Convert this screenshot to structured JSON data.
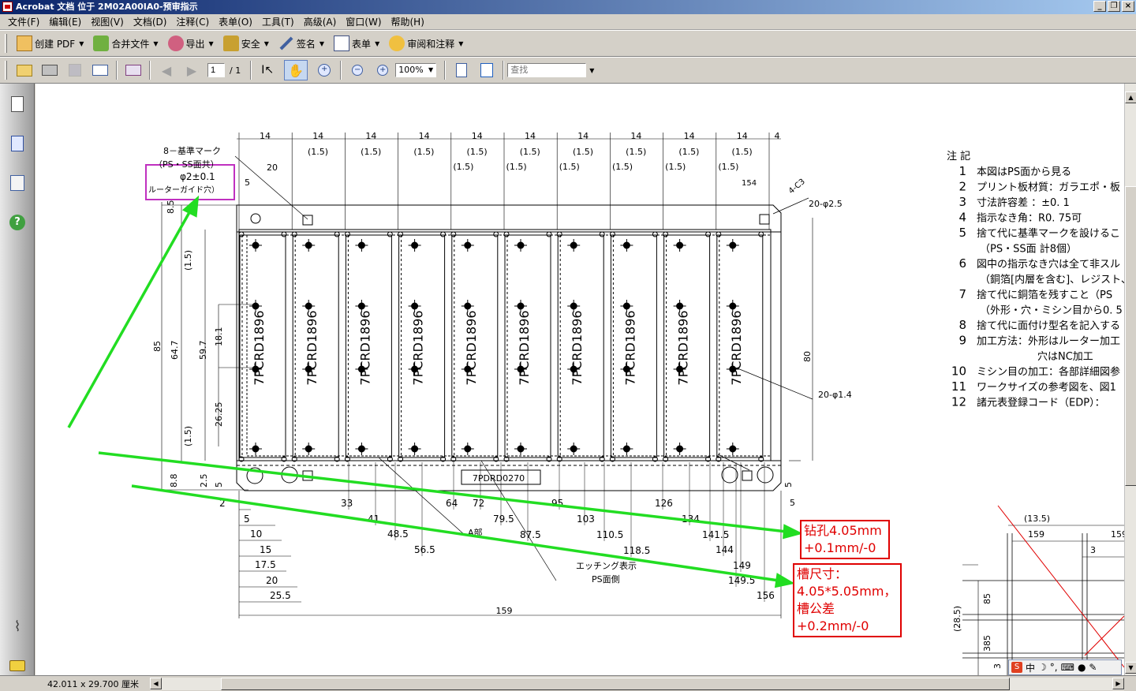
{
  "window": {
    "title": "Acrobat 文档 位于 2M02A00IA0-预审指示"
  },
  "menu": [
    "文件(F)",
    "编辑(E)",
    "视图(V)",
    "文档(D)",
    "注释(C)",
    "表单(O)",
    "工具(T)",
    "高级(A)",
    "窗口(W)",
    "帮助(H)"
  ],
  "toolbar1": {
    "create_pdf": "创建 PDF",
    "combine": "合并文件",
    "export": "导出",
    "security": "安全",
    "sign": "签名",
    "forms": "表单",
    "review": "审阅和注释"
  },
  "toolbar2": {
    "page_current": "1",
    "page_total": "/ 1",
    "zoom": "100%",
    "find_placeholder": "查找"
  },
  "status": {
    "page_size": "42.011 x 29.700 厘米"
  },
  "ime": {
    "logo": "S",
    "mode": "中"
  },
  "drawing": {
    "part_labels": [
      "7PCRD1896",
      "7PCRD1896",
      "7PCRD1896",
      "7PCRD1896",
      "7PCRD1896",
      "7PCRD1896",
      "7PCRD1896",
      "7PCRD1896",
      "7PCRD1896",
      "7PCRD1896"
    ],
    "frame_label": "7PDRD0270",
    "top_pitch": [
      "14",
      "14",
      "14",
      "14",
      "14",
      "14",
      "14",
      "14",
      "14",
      "14",
      "4"
    ],
    "top_gap": [
      "(1.5)",
      "(1.5)",
      "(1.5)",
      "(1.5)",
      "(1.5)",
      "(1.5)",
      "(1.5)",
      "(1.5)",
      "(1.5)"
    ],
    "top_gap2": [
      "(1.5)",
      "(1.5)",
      "(1.5)",
      "(1.5)",
      "(1.5)",
      "(1.5)"
    ],
    "dim_20_top": "20",
    "dim_5_top": "5",
    "dim_154": "154",
    "dim_4c3": "4-C3",
    "hole_20_25": "20-φ2.5",
    "hole_20_14": "20-φ1.4",
    "mark_label_1": "8－基準マーク",
    "mark_label_2": "（PS・SS面共）",
    "guide_hole_1": "φ2±0.1",
    "guide_hole_2": "ルーターガイド穴）",
    "left_dims": [
      "8.5",
      "(1.5)",
      "85",
      "64.7",
      "59.7",
      "18.1",
      "26.25",
      "(1.5)",
      "8.8",
      "2.5",
      "5"
    ],
    "right_dim_80": "80",
    "right_dim_5a": "5",
    "right_dim_5b": "5",
    "bottom_dims": [
      "33",
      "41",
      "48.5",
      "56.5",
      "64",
      "72",
      "79.5",
      "87.5",
      "95",
      "103",
      "110.5",
      "118.5",
      "126",
      "134",
      "141.5",
      "144",
      "149",
      "149.5",
      "156"
    ],
    "bottom_left_dims": [
      "2",
      "5",
      "10",
      "15",
      "17.5",
      "20",
      "25.5"
    ],
    "overall_159": "159",
    "a_part": "A部",
    "etching_1": "エッチング表示",
    "etching_2": "PS面側",
    "notes_title": "注  記",
    "notes": [
      {
        "n": "1",
        "t": "本図はPS面から見る"
      },
      {
        "n": "2",
        "t": "プリント板材質：ガラエポ・板"
      },
      {
        "n": "3",
        "t": "寸法許容差  ：±0. 1"
      },
      {
        "n": "4",
        "t": "指示なき角：R0. 75可"
      },
      {
        "n": "5",
        "t": "捨て代に基準マークを設けるこ"
      },
      {
        "n": "",
        "t": "（PS・SS面  計8個）"
      },
      {
        "n": "6",
        "t": "図中の指示なき穴は全て非スル"
      },
      {
        "n": "",
        "t": "（銅箔[内層を含む]、レジスト、"
      },
      {
        "n": "7",
        "t": "捨て代に銅箔を残すこと（PS"
      },
      {
        "n": "",
        "t": "（外形・穴・ミシン目から0. 5"
      },
      {
        "n": "8",
        "t": "捨て代に面付け型名を記入する"
      },
      {
        "n": "9",
        "t": "加工方法：外形はルーター加工"
      },
      {
        "n": "",
        "t": "穴はNC加工"
      },
      {
        "n": "10",
        "t": "ミシン目の加工：各部詳細図参"
      },
      {
        "n": "11",
        "t": "ワークサイズの参考図を、図1"
      },
      {
        "n": "12",
        "t": "諸元表登録コード（EDP）："
      }
    ],
    "detail_dims": [
      "(13.5)",
      "159",
      "159",
      "3",
      "(28.5)",
      "85",
      "3",
      "85",
      "3"
    ]
  },
  "annotations": {
    "drill_1": "钻孔4.05mm",
    "drill_2": "+0.1mm/-0",
    "slot_1": "槽尺寸：",
    "slot_2": "4.05*5.05mm，",
    "slot_3": "槽公差",
    "slot_4": "+0.2mm/-0"
  },
  "colors": {
    "title_bar": "#0a246a",
    "highlight_box": "#c030c0",
    "arrows": "#22dd22",
    "annotation": "#e00000"
  }
}
